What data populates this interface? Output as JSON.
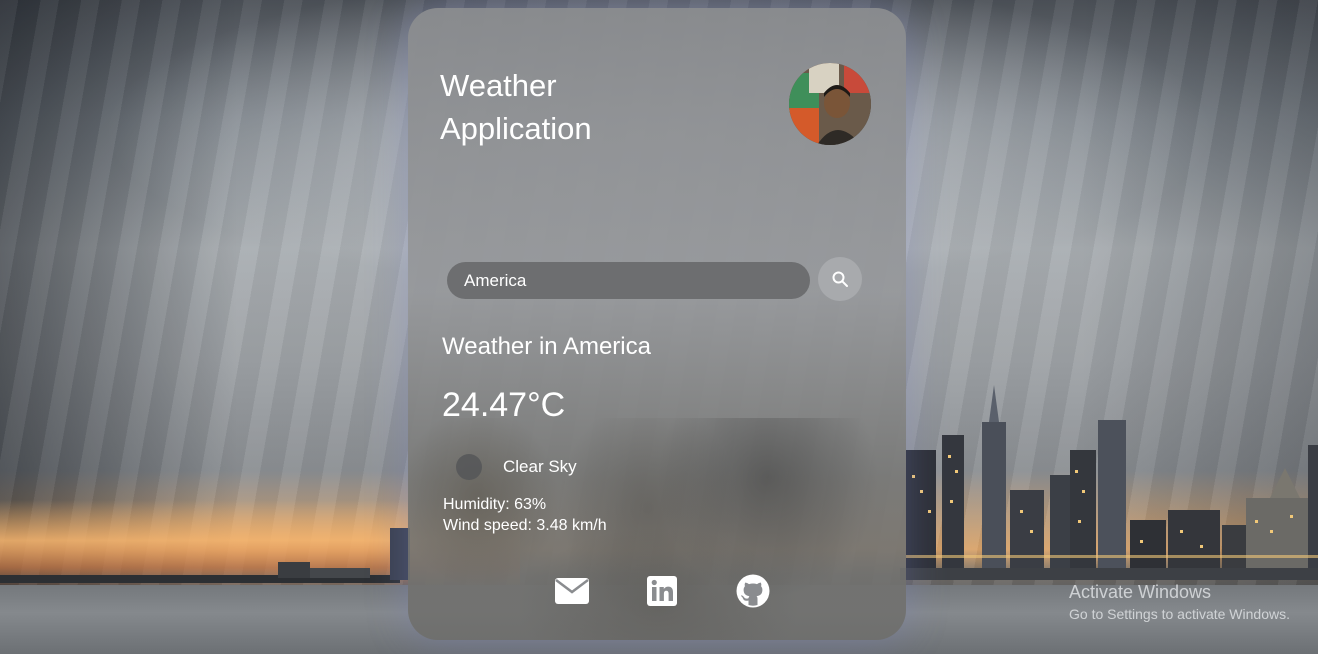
{
  "app": {
    "title_line1": "Weather",
    "title_line2": "Application"
  },
  "search": {
    "value": "America",
    "placeholder": "Search"
  },
  "weather": {
    "city_heading": "Weather in America",
    "temperature": "24.47°C",
    "description": "Clear Sky",
    "humidity": "Humidity: 63%",
    "wind": "Wind speed: 3.48 km/h"
  },
  "social_icons": [
    "envelope-icon",
    "linkedin-icon",
    "github-icon"
  ],
  "watermark": {
    "title": "Activate Windows",
    "subtitle": "Go to Settings to activate Windows."
  },
  "colors": {
    "text": "#ffffff",
    "card": "#8c8e91",
    "input_bg": "#5f6062",
    "search_button_bg": "#aaacaf"
  }
}
